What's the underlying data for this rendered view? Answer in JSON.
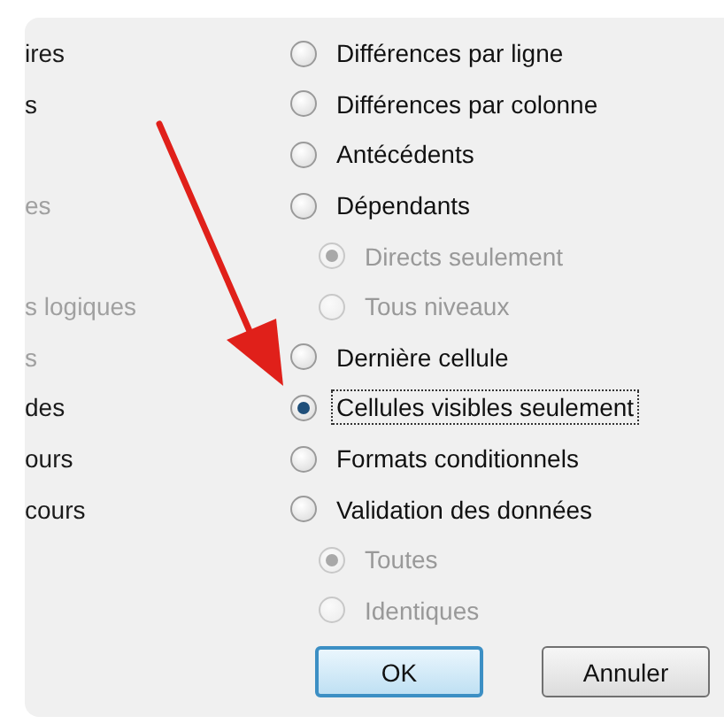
{
  "rows": [
    {
      "left": {
        "text": "ires",
        "disabled": false
      },
      "right": {
        "kind": "option",
        "label": "Différences par ligne",
        "selected": false,
        "disabled": false,
        "focused": false
      }
    },
    {
      "left": {
        "text": "s",
        "disabled": false
      },
      "right": {
        "kind": "option",
        "label": "Différences par colonne",
        "selected": false,
        "disabled": false,
        "focused": false
      }
    },
    {
      "right": {
        "kind": "option",
        "label": "Antécédents",
        "selected": false,
        "disabled": false,
        "focused": false
      }
    },
    {
      "left": {
        "text": "es",
        "disabled": true
      },
      "right": {
        "kind": "option",
        "label": "Dépendants",
        "selected": false,
        "disabled": false,
        "focused": false
      }
    },
    {
      "right": {
        "kind": "sub-option",
        "label": "Directs seulement",
        "selected": true,
        "disabled": true,
        "focused": false
      }
    },
    {
      "left": {
        "text": "s logiques",
        "disabled": true
      },
      "right": {
        "kind": "sub-option",
        "label": "Tous niveaux",
        "selected": false,
        "disabled": true,
        "focused": false
      }
    },
    {
      "left": {
        "text": "s",
        "disabled": true
      },
      "right": {
        "kind": "option",
        "label": "Dernière cellule",
        "selected": false,
        "disabled": false,
        "focused": false
      }
    },
    {
      "left": {
        "text": "des",
        "disabled": false
      },
      "right": {
        "kind": "option",
        "label": "Cellules visibles seulement",
        "selected": true,
        "disabled": false,
        "focused": true
      }
    },
    {
      "left": {
        "text": "ours",
        "disabled": false
      },
      "right": {
        "kind": "option",
        "label": "Formats conditionnels",
        "selected": false,
        "disabled": false,
        "focused": false
      }
    },
    {
      "left": {
        "text": "cours",
        "disabled": false
      },
      "right": {
        "kind": "option",
        "label": "Validation des données",
        "selected": false,
        "disabled": false,
        "focused": false
      }
    },
    {
      "right": {
        "kind": "sub-option",
        "label": "Toutes",
        "selected": true,
        "disabled": true,
        "focused": false
      }
    },
    {
      "right": {
        "kind": "sub-option",
        "label": "Identiques",
        "selected": false,
        "disabled": true,
        "focused": false
      }
    }
  ],
  "buttons": [
    {
      "label": "OK",
      "default": true
    },
    {
      "label": "Annuler",
      "default": false
    }
  ]
}
